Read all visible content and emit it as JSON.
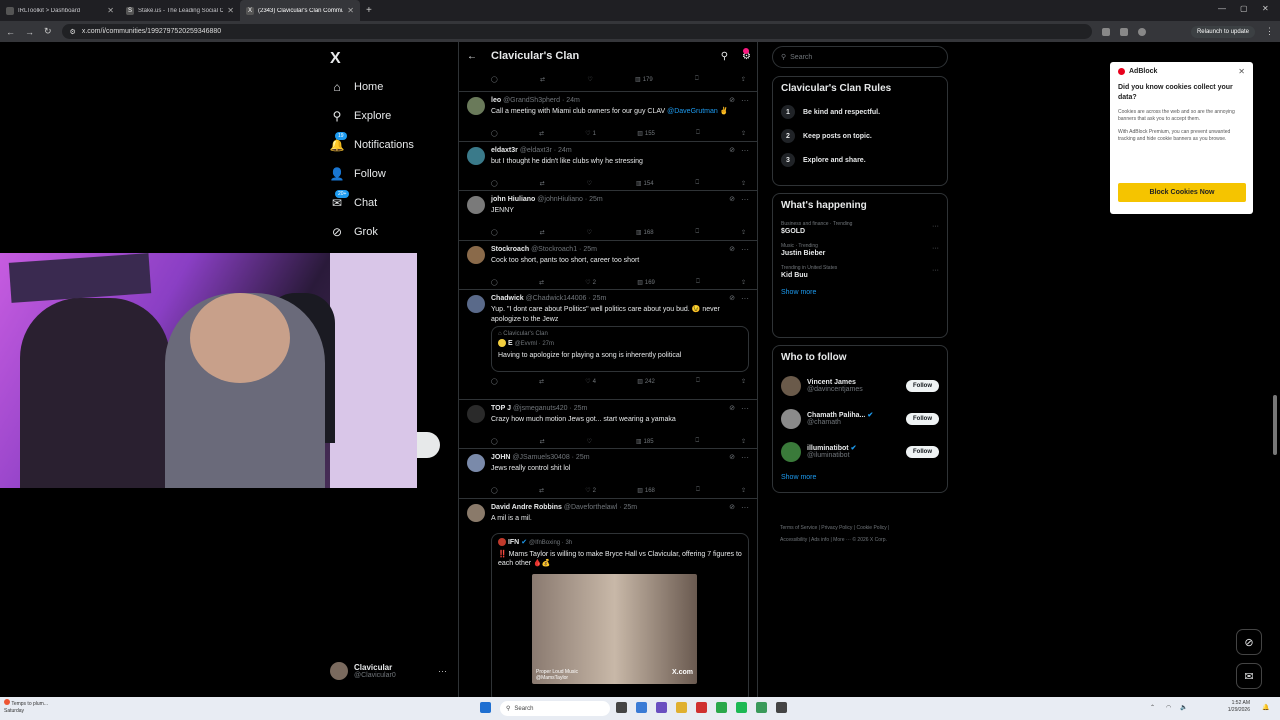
{
  "browser": {
    "tabs": [
      {
        "title": "IRLToolkit > Dashboard"
      },
      {
        "title": "Stake.us - The Leading Social C"
      },
      {
        "title": "(2343) Clavicular's Clan Commu"
      }
    ],
    "new_tab": "+",
    "url": "x.com/i/communities/1992797520259346880",
    "relaunch": "Relaunch to update"
  },
  "leftnav": {
    "logo": "X",
    "items": [
      {
        "label": "Home",
        "icon": "home-icon",
        "glyph": "⌂"
      },
      {
        "label": "Explore",
        "icon": "search-icon",
        "glyph": "⚲"
      },
      {
        "label": "Notifications",
        "icon": "bell-icon",
        "glyph": "🔔",
        "badge": "19"
      },
      {
        "label": "Follow",
        "icon": "follow-icon",
        "glyph": "👤"
      },
      {
        "label": "Chat",
        "icon": "chat-icon",
        "glyph": "✉",
        "badge": "20+"
      },
      {
        "label": "Grok",
        "icon": "grok-icon",
        "glyph": "⊘"
      }
    ],
    "account": {
      "name": "Clavicular",
      "handle": "@Clavicular0",
      "more": "···"
    }
  },
  "column": {
    "title": "Clavicular's Clan",
    "first_actions": {
      "views": "179"
    },
    "posts": [
      {
        "name": "leo",
        "handle": "@GrandSh3pherd · 24m",
        "text": "Call a meeting with Miami club owners for our guy CLAV",
        "mention": "@DaveGrutman",
        "emoji": "✌",
        "likes": "1",
        "views": "155"
      },
      {
        "name": "eldaxt3r",
        "handle": "@eldaxt3r · 24m",
        "text": "but I thought he didn't like clubs why he stressing",
        "likes": "",
        "views": "154"
      },
      {
        "name": "john Hiuliano",
        "handle": "@johnHiuliano · 25m",
        "text": "JENNY",
        "likes": "",
        "views": "168"
      },
      {
        "name": "Stockroach",
        "handle": "@Stockroach1 · 25m",
        "text": "Cock too short, pants too short, career too short",
        "likes": "2",
        "views": "169"
      },
      {
        "name": "Chadwick",
        "handle": "@Chadwick144006 · 25m",
        "text": "Yup. \"I dont care about Politics\" well politics care about you bud. 😉 never apologize to the Jewz",
        "likes": "4",
        "views": "242",
        "quote": {
          "community": "Clavicular's Clan",
          "name": "E",
          "handle": "@Evvml · 27m",
          "text": "Having to apologize for playing a song is inherently political"
        }
      },
      {
        "name": "TOP J",
        "handle": "@jsmeganuts420 · 25m",
        "text": "Crazy how much motion Jews got... start wearing a yamaka",
        "likes": "",
        "views": "185"
      },
      {
        "name": "JOHN",
        "handle": "@JSamuels30408 · 25m",
        "text": "Jews really control shit lol",
        "likes": "2",
        "views": "168"
      },
      {
        "name": "David Andre Robbins",
        "handle": "@Daveforthelawl · 25m",
        "text": "A mil is a mil.",
        "quote": {
          "name": "IFN",
          "handle": "@IfnBoxing · 3h",
          "text": "‼️ Mams Taylor is willing to make Bryce Hall vs Clavicular, offering 7 figures to each other 🩸💰",
          "image_caption": "Proper Loud Music",
          "image_handle": "@MamsTaylor",
          "image_brand": "X.com"
        }
      }
    ]
  },
  "right": {
    "search_placeholder": "Search",
    "rules": {
      "title": "Clavicular's Clan Rules",
      "items": [
        {
          "n": "1",
          "text": "Be kind and respectful."
        },
        {
          "n": "2",
          "text": "Keep posts on topic."
        },
        {
          "n": "3",
          "text": "Explore and share."
        }
      ]
    },
    "happening": {
      "title": "What's happening",
      "items": [
        {
          "context": "Business and finance · Trending",
          "name": "$GOLD"
        },
        {
          "context": "Music · Trending",
          "name": "Justin Bieber"
        },
        {
          "context": "Trending in United States",
          "name": "Kid Buu"
        }
      ],
      "show_more": "Show more"
    },
    "who_to_follow": {
      "title": "Who to follow",
      "items": [
        {
          "name": "Vincent James",
          "handle": "@davincentjames",
          "button": "Follow"
        },
        {
          "name": "Chamath Paliha...",
          "handle": "@chamath",
          "button": "Follow"
        },
        {
          "name": "illuminatibot",
          "handle": "@iluminatibot",
          "button": "Follow"
        }
      ],
      "show_more": "Show more"
    },
    "footer": {
      "line1": "Terms of Service  |  Privacy Policy  |  Cookie Policy  |",
      "line2": "Accessibility  |  Ads info  |  More ···  © 2026 X Corp."
    }
  },
  "adblock": {
    "brand": "AdBlock",
    "question": "Did you know cookies collect your data?",
    "p1": "Cookies are across the web and so are the annoying banners that ask you to accept them.",
    "p2": "With AdBlock Premium, you can prevent unwanted tracking and hide cookie banners as you browse.",
    "button": "Block Cookies Now"
  },
  "taskbar": {
    "weather": "Temps to plum...",
    "weather_sub": "Saturday",
    "search": "Search",
    "time": "1:52 AM",
    "date": "1/29/2026"
  },
  "colors": {
    "accent": "#1d9bf0",
    "background": "#000000",
    "adblock_button": "#f5c400"
  }
}
